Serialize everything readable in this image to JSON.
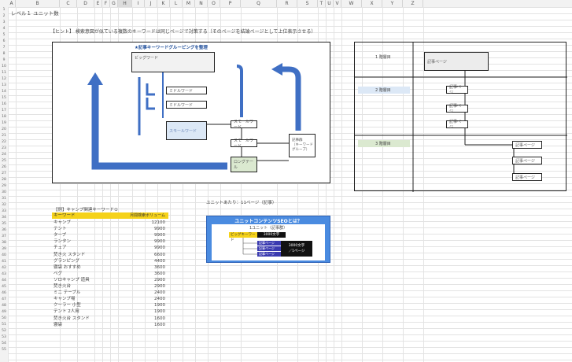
{
  "sheet": {
    "columns": [
      "A",
      "B",
      "C",
      "D",
      "E",
      "F",
      "G",
      "H",
      "I",
      "J",
      "K",
      "L",
      "M",
      "N",
      "O",
      "P",
      "Q",
      "R",
      "S",
      "T",
      "U",
      "V",
      "W",
      "X",
      "Y",
      "Z"
    ],
    "rows": [
      "1",
      "2",
      "3",
      "4",
      "5",
      "6",
      "7",
      "8",
      "9",
      "10",
      "11",
      "12",
      "13",
      "14",
      "15",
      "16",
      "17",
      "18",
      "19",
      "20",
      "21",
      "22",
      "23",
      "24",
      "25",
      "26",
      "27",
      "28",
      "29",
      "30",
      "31",
      "32",
      "33",
      "34",
      "35",
      "36",
      "37",
      "38",
      "39",
      "40",
      "41",
      "42",
      "43",
      "44",
      "45",
      "46",
      "47",
      "48",
      "49",
      "50",
      "51",
      "52",
      "53",
      "54",
      "55"
    ]
  },
  "cells": {
    "title": "レベル１ ユニット数",
    "hint": "【ヒント】 検索意図が似ている複数のキーワードは同じページで対策する（そのページを結論ページとして上位表示させる）"
  },
  "diagram_left": {
    "heading": "★記事キーワードグルーピングを整理",
    "big_box": "ビッグワード",
    "mid1": "ミドルワード",
    "mid2": "ミドルワード",
    "blue_box": "スモールワード",
    "small1": "スモールワード",
    "small2": "スモールワード",
    "green_box": "ロングテール",
    "side_box_lines": [
      "記事群",
      "（キーワード",
      "グループ）"
    ]
  },
  "diagram_right": {
    "level1": "1 階層目",
    "level2": "2 階層目",
    "level3": "3 階層目",
    "top_page": "記事ページ",
    "mid_pages": [
      "記事ページ",
      "記事ページ",
      "記事ページ"
    ],
    "bottom_pages": [
      "記事ページ",
      "記事ページ",
      "記事ページ"
    ]
  },
  "keyword_table": {
    "title": "【例】キャンプ関連キーワード①",
    "col_keyword": "キーワード",
    "col_volume": "月間検索ボリューム",
    "rows": [
      {
        "k": "キャンプ",
        "v": "12100"
      },
      {
        "k": "テント",
        "v": "9900"
      },
      {
        "k": "タープ",
        "v": "9900"
      },
      {
        "k": "ランタン",
        "v": "9900"
      },
      {
        "k": "チェア",
        "v": "9900"
      },
      {
        "k": "焚き火 スタンド",
        "v": "6600"
      },
      {
        "k": "グランピング",
        "v": "4400"
      },
      {
        "k": "寝袋 おすすめ",
        "v": "3600"
      },
      {
        "k": "ペグ",
        "v": "3600"
      },
      {
        "k": "ソロキャンプ 道具",
        "v": "2900"
      },
      {
        "k": "焚き火台",
        "v": "2900"
      },
      {
        "k": "ミニ テーブル",
        "v": "2400"
      },
      {
        "k": "キャンプ場",
        "v": "2400"
      },
      {
        "k": "クーラー 小型",
        "v": "1900"
      },
      {
        "k": "テント 2人用",
        "v": "1900"
      },
      {
        "k": "焚き火台 スタンド",
        "v": "1600"
      },
      {
        "k": "寝袋",
        "v": "1600"
      }
    ]
  },
  "unit_info": {
    "caption": "ユニットあたり：11ページ（記事）",
    "panel_title": "ユニットコンテンツSEOとは？",
    "panel_sub": "1ユニット（記事群）",
    "top_label": "ビッグキーワード",
    "top_value": "3000文字",
    "child_labels": [
      "記事ページ",
      "記事ページ",
      "記事ページ"
    ],
    "child_value_lines": [
      "3000文字",
      "／1ページ"
    ]
  },
  "colors": {
    "arrow_blue": "#3f6fc4",
    "panel_blue": "#4a8be0",
    "header_yellow": "#f5d21a",
    "green_box": "#dbe9d0",
    "light_blue_box": "#dce8f6"
  }
}
